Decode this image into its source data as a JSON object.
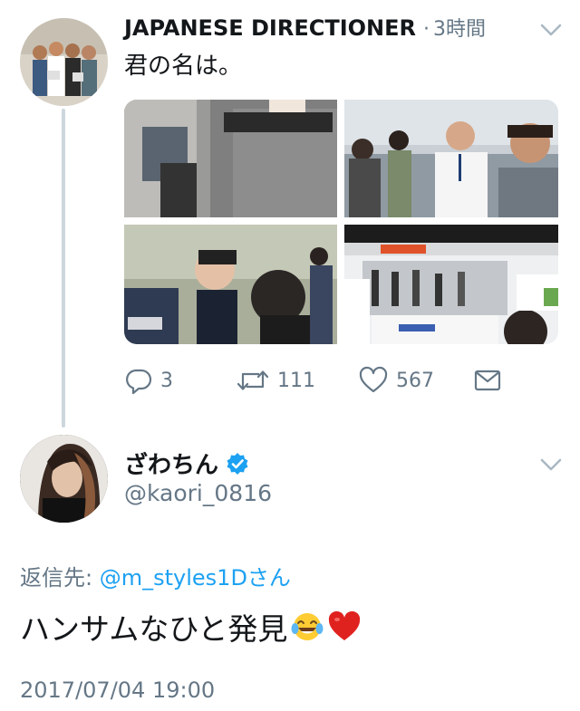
{
  "tweet1": {
    "author_name": "JAPANESE DIRECTIONER",
    "separator": "·",
    "time": "3時間",
    "text": "君の名は。",
    "actions": {
      "reply_count": "3",
      "retweet_count": "111",
      "like_count": "567"
    },
    "media_count": 4
  },
  "tweet2": {
    "author_name": "ざわちん",
    "handle": "@kaori_0816",
    "reply_label": "返信先:",
    "reply_mention": "@m_styles1Dさん",
    "text": "ハンサムなひと発見",
    "emojis": [
      "face-with-tears-of-joy",
      "red-heart"
    ],
    "timestamp": "2017/07/04 19:00",
    "verified": true
  },
  "icons": {
    "reply": "reply-icon",
    "retweet": "retweet-icon",
    "like": "heart-icon",
    "dm": "envelope-icon",
    "menu": "chevron-down-icon",
    "verified": "verified-badge-icon"
  },
  "colors": {
    "text": "#14171a",
    "secondary": "#657786",
    "link": "#1da1f2",
    "thread_line": "#ccd6dd",
    "verified": "#1da1f2"
  }
}
